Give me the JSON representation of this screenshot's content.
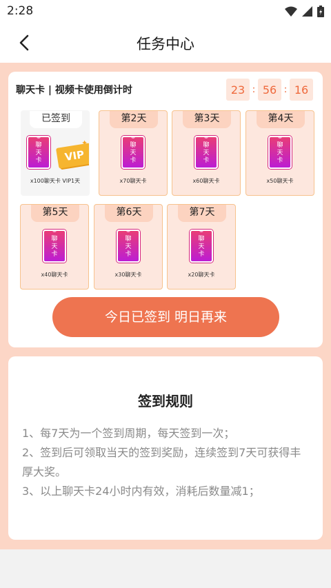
{
  "status_bar": {
    "time": "2:28"
  },
  "header": {
    "title": "任务中心"
  },
  "countdown": {
    "label": "聊天卡 | 视频卡使用倒计时",
    "hours": "23",
    "minutes": "56",
    "seconds": "16",
    "separator": ":"
  },
  "days": [
    {
      "label": "已签到",
      "badge": "聊天卡",
      "vip_badge": "VIP",
      "caption": "x100聊天卡 VIP1天",
      "signed": true
    },
    {
      "label": "第2天",
      "badge": "聊天卡",
      "caption": "x70聊天卡"
    },
    {
      "label": "第3天",
      "badge": "聊天卡",
      "caption": "x60聊天卡"
    },
    {
      "label": "第4天",
      "badge": "聊天卡",
      "caption": "x50聊天卡"
    },
    {
      "label": "第5天",
      "badge": "聊天卡",
      "caption": "x40聊天卡"
    },
    {
      "label": "第6天",
      "badge": "聊天卡",
      "caption": "x30聊天卡"
    },
    {
      "label": "第7天",
      "badge": "聊天卡",
      "caption": "x20聊天卡"
    }
  ],
  "signin_button": {
    "label": "今日已签到 明日再来"
  },
  "rules": {
    "title": "签到规则",
    "items": [
      "1、每7天为一个签到周期，每天签到一次；",
      "2、签到后可领取当天的签到奖励，连续签到7天可获得丰厚大奖。",
      "3、以上聊天卡24小时内有效，消耗后数量减1；"
    ]
  },
  "colors": {
    "accent": "#ee7450",
    "page_background": "#fcd6c6",
    "timer_text": "#ef6a3d",
    "badge_gradient_top": "#e93d77",
    "badge_gradient_bottom": "#bc1dd3"
  },
  "icons": [
    "wifi-icon",
    "signal-icon",
    "battery-icon",
    "back-arrow-icon",
    "chat-card-icon",
    "vip-card-icon"
  ]
}
